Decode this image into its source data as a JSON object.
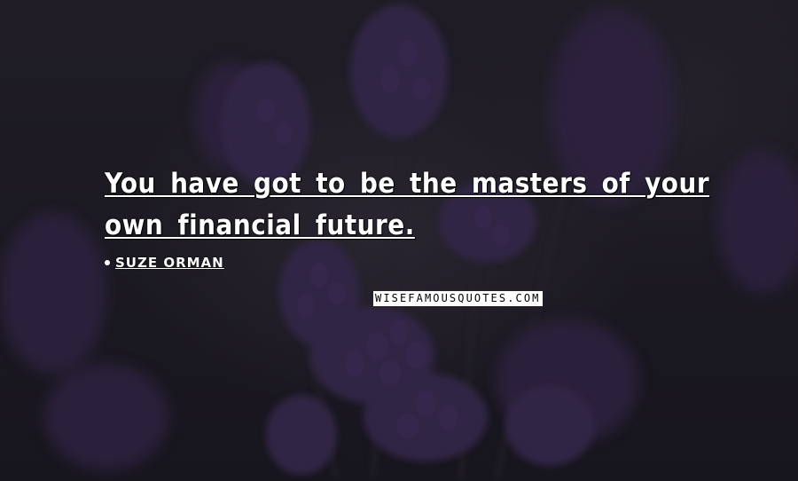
{
  "quote": {
    "text": "You have got to be the masters of your own financial future.",
    "author": "Suze Orman"
  },
  "watermark": "WISEFAMOUSQUOTES.COM",
  "colors": {
    "background": "#221f28",
    "flowers": "#3e2c56",
    "text": "#ffffff"
  }
}
